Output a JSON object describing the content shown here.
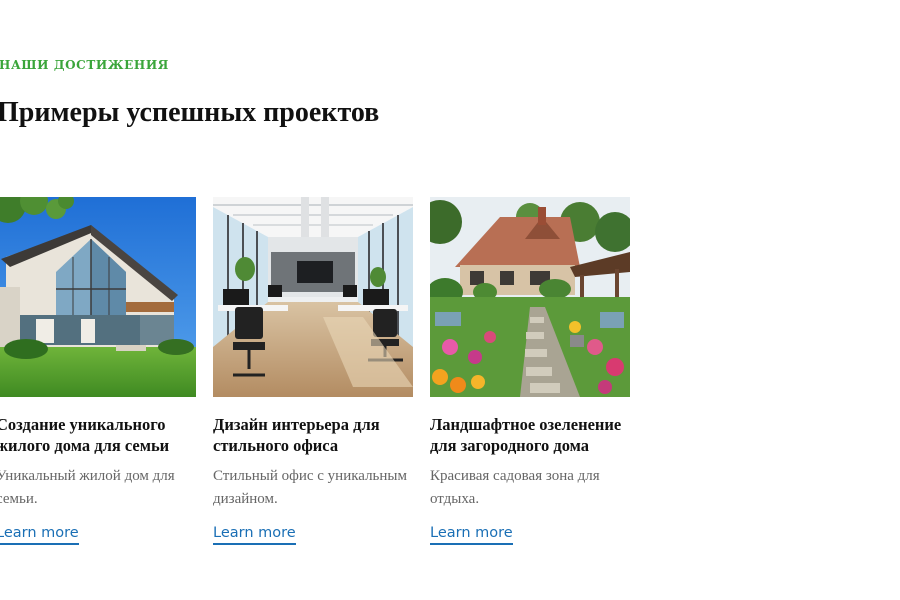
{
  "section": {
    "eyebrow": "НАШИ ДОСТИЖЕНИЯ",
    "title": "Примеры успешных проектов"
  },
  "cards": [
    {
      "title": "Создание уникального жилого дома для семьи",
      "description": "Уникальный жилой дом для семьи.",
      "link_label": "Learn more",
      "image": "modern-house-photo"
    },
    {
      "title": "Дизайн интерьера для стильного офиса",
      "description": "Стильный офис с уникальным дизайном.",
      "link_label": "Learn more",
      "image": "office-interior-photo"
    },
    {
      "title": "Ландшафтное озеленение для загородного дома",
      "description": "Красивая садовая зона для отдыха.",
      "link_label": "Learn more",
      "image": "garden-landscape-photo"
    }
  ],
  "colors": {
    "accent_green": "#3aa53a",
    "link_blue": "#1a6fb5",
    "heading": "#111111",
    "body_text": "#666666"
  }
}
